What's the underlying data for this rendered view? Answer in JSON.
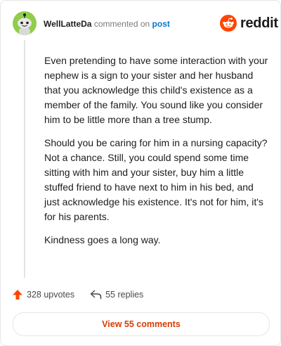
{
  "header": {
    "username": "WellLatteDa",
    "commented_on": "commented on",
    "post_link": "post",
    "logo_text": "reddit"
  },
  "comment": {
    "paragraphs": [
      "Even pretending to have some interaction with your nephew is a sign to your sister and her husband that you acknowledge this child's existence as a member of the family. You sound like you consider him to be little more than a tree stump.",
      "Should you be caring for him in a nursing capacity? Not a chance. Still, you could spend some time sitting with him and your sister, buy him a little stuffed friend to have next to him in his bed, and just acknowledge his existence. It's not for him, it's for his parents.",
      "Kindness goes a long way."
    ]
  },
  "actions": {
    "upvotes": "328 upvotes",
    "replies": "55 replies",
    "upvote_icon": "upvote-arrow-icon",
    "reply_icon": "reply-arrow-icon"
  },
  "view_button": "View 55 comments",
  "colors": {
    "brand": "#ff4500",
    "link": "#0079d3",
    "view_button_text": "#d93a00",
    "avatar_bg": "#8fcd4a"
  }
}
